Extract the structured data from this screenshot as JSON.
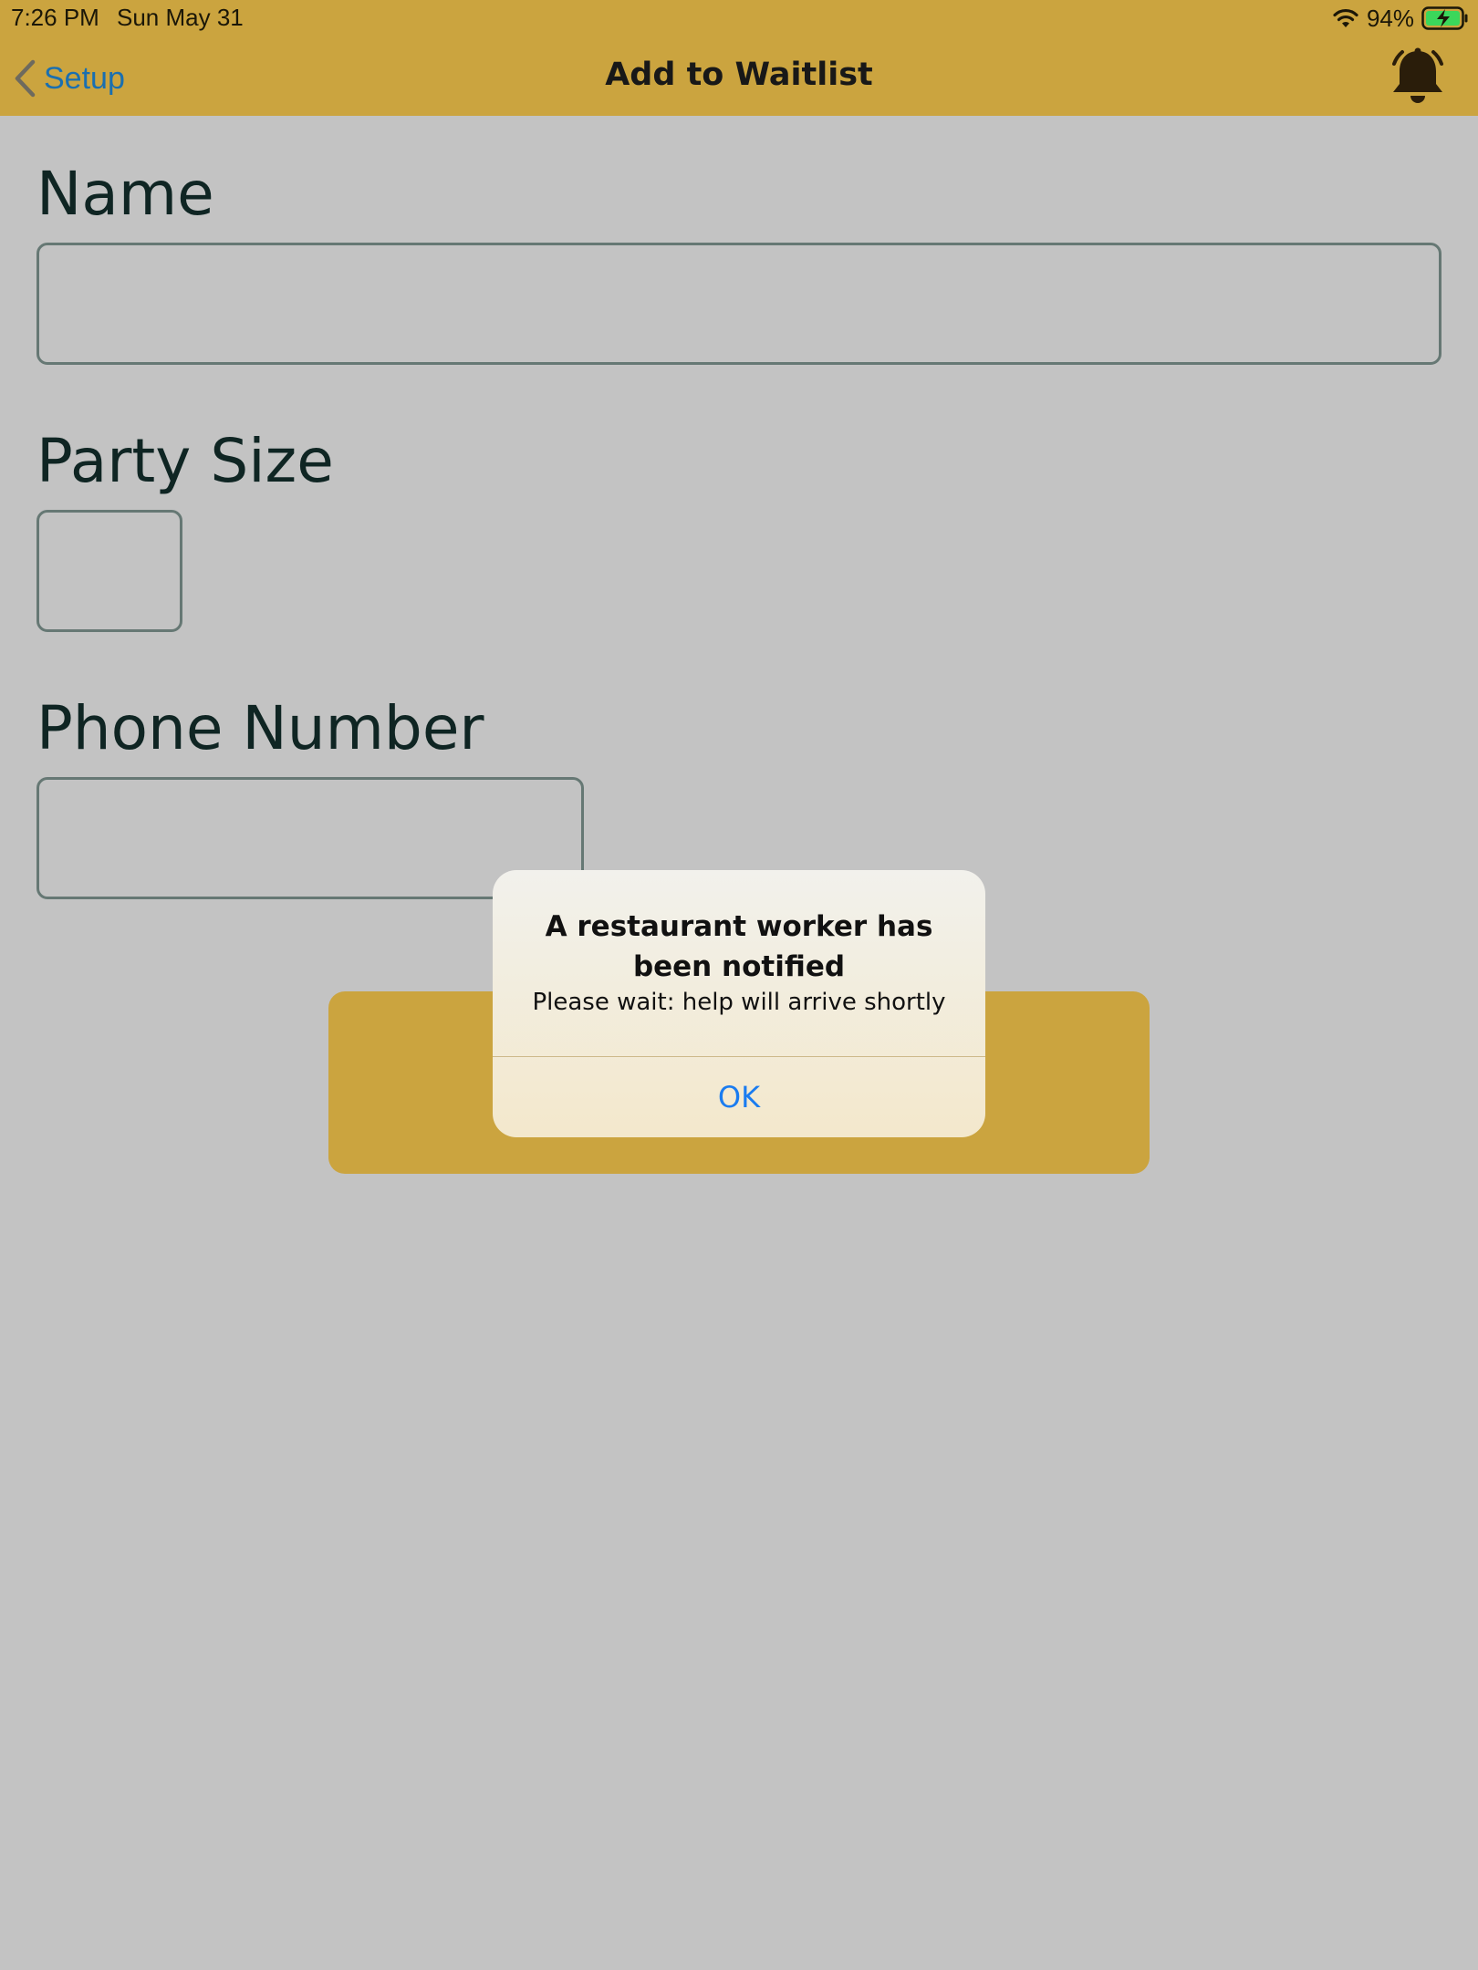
{
  "status_bar": {
    "time": "7:26 PM",
    "date": "Sun May 31",
    "battery_percent": "94%"
  },
  "nav": {
    "back_label": "Setup",
    "title": "Add to Waitlist",
    "bell_icon": "bell-icon"
  },
  "form": {
    "name_label": "Name",
    "name_value": "",
    "party_size_label": "Party Size",
    "party_size_value": "",
    "phone_label": "Phone Number",
    "phone_value": ""
  },
  "alert": {
    "title": "A restaurant worker has been notified",
    "message": "Please wait: help will arrive shortly",
    "ok_label": "OK"
  },
  "colors": {
    "bar": "#cba43f",
    "background": "#c3c3c3",
    "link_blue": "#1a6fb0",
    "ok_blue": "#1a7cf0"
  }
}
